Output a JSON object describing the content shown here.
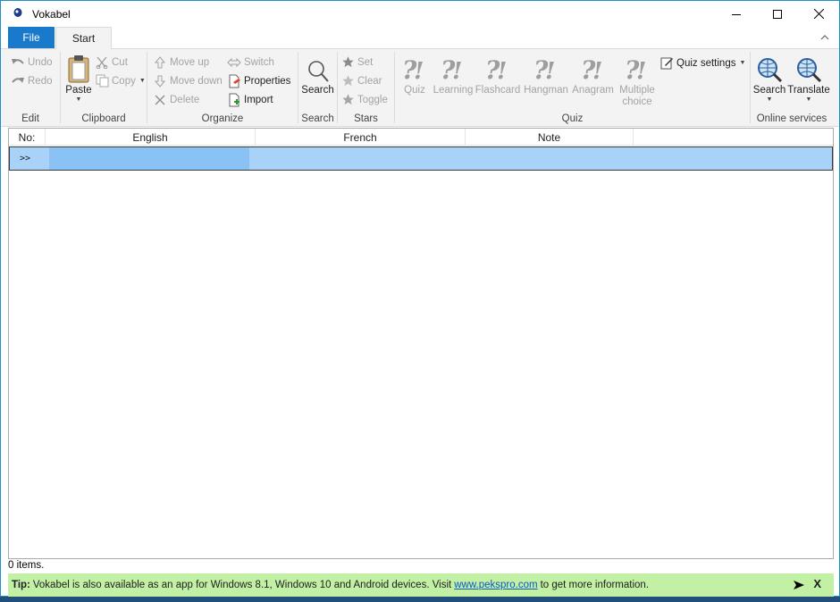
{
  "window": {
    "title": "Vokabel"
  },
  "tabs": {
    "file": "File",
    "start": "Start"
  },
  "ribbon": {
    "edit": {
      "label": "Edit",
      "undo": "Undo",
      "redo": "Redo"
    },
    "clipboard": {
      "label": "Clipboard",
      "paste": "Paste",
      "cut": "Cut",
      "copy": "Copy"
    },
    "organize": {
      "label": "Organize",
      "move_up": "Move up",
      "move_down": "Move down",
      "delete": "Delete",
      "switch": "Switch",
      "properties": "Properties",
      "import": "Import"
    },
    "search": {
      "label": "Search",
      "search": "Search"
    },
    "stars": {
      "label": "Stars",
      "set": "Set",
      "clear": "Clear",
      "toggle": "Toggle"
    },
    "quiz": {
      "label": "Quiz",
      "quiz": "Quiz",
      "learning": "Learning",
      "flashcard": "Flashcard",
      "hangman": "Hangman",
      "anagram": "Anagram",
      "multiple_1": "Multiple",
      "multiple_2": "choice",
      "settings": "Quiz settings"
    },
    "online": {
      "label": "Online services",
      "search": "Search",
      "translate": "Translate"
    }
  },
  "list": {
    "columns": [
      "No:",
      "English",
      "French",
      "Note"
    ],
    "new_row_marker": ">>"
  },
  "status": {
    "items": "0 items."
  },
  "tip": {
    "prefix": "Tip:",
    "text": "Vokabel is also available as an app for Windows 8.1, Windows 10 and Android devices. Visit",
    "link": "www.pekspro.com",
    "suffix": "to get more information.",
    "close": "X"
  },
  "colors": {
    "accent": "#1979ca",
    "selection": "#a8d2f8",
    "tip_bg": "#c2f0a4"
  }
}
